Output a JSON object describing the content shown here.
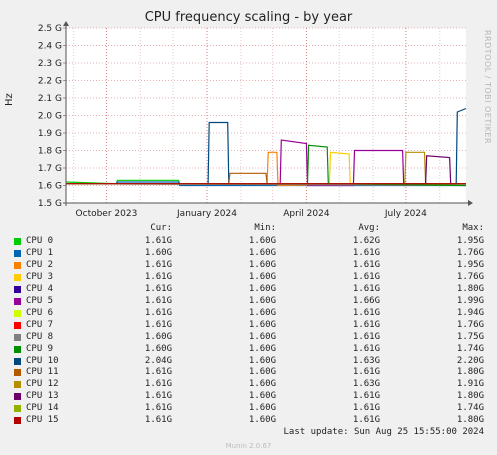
{
  "title": "CPU frequency scaling - by year",
  "side_credit": "RRDTOOL / TOBI OETIKER",
  "footer": {
    "last_update": "Last update: Sun Aug 25 15:55:00 2024",
    "generator": "Munin 2.0.67"
  },
  "legend_headers": {
    "cur": "Cur:",
    "min": "Min:",
    "avg": "Avg:",
    "max": "Max:"
  },
  "chart_data": {
    "type": "line",
    "title": "CPU frequency scaling - by year",
    "ylabel": "Hz",
    "ylim": [
      1.5,
      2.5
    ],
    "y_ticks": [
      {
        "value": 2.5,
        "label": "2.5 G"
      },
      {
        "value": 2.4,
        "label": "2.4 G"
      },
      {
        "value": 2.3,
        "label": "2.3 G"
      },
      {
        "value": 2.2,
        "label": "2.2 G"
      },
      {
        "value": 2.1,
        "label": "2.1 G"
      },
      {
        "value": 2.0,
        "label": "2.0 G"
      },
      {
        "value": 1.9,
        "label": "1.9 G"
      },
      {
        "value": 1.8,
        "label": "1.8 G"
      },
      {
        "value": 1.7,
        "label": "1.7 G"
      },
      {
        "value": 1.6,
        "label": "1.6 G"
      },
      {
        "value": 1.5,
        "label": "1.5 G"
      }
    ],
    "x_range": [
      "2023-08-25",
      "2024-08-25"
    ],
    "x_ticks": [
      {
        "date": "2023-10-01",
        "label": "October 2023"
      },
      {
        "date": "2024-01-01",
        "label": "January 2024"
      },
      {
        "date": "2024-04-01",
        "label": "April 2024"
      },
      {
        "date": "2024-07-01",
        "label": "July 2024"
      }
    ],
    "x_minor_ticks": [
      "2023-09-01",
      "2023-11-01",
      "2023-12-01",
      "2024-02-01",
      "2024-03-01",
      "2024-05-01",
      "2024-06-01",
      "2024-08-01"
    ],
    "grid": true,
    "legend_position": "bottom",
    "series": [
      {
        "name": "CPU 0",
        "color": "#00cc00",
        "cur": "1.61G",
        "min": "1.60G",
        "avg": "1.62G",
        "max": "1.95G",
        "points": [
          [
            "2023-08-25",
            1.62
          ],
          [
            "2023-10-10",
            1.61
          ],
          [
            "2023-10-11",
            1.63
          ],
          [
            "2023-12-06",
            1.63
          ],
          [
            "2023-12-07",
            1.61
          ],
          [
            "2024-02-20",
            1.61
          ],
          [
            "2024-02-22",
            1.61
          ],
          [
            "2024-08-25",
            1.61
          ]
        ]
      },
      {
        "name": "CPU 1",
        "color": "#0066b3",
        "cur": "1.60G",
        "min": "1.60G",
        "avg": "1.61G",
        "max": "1.76G",
        "points": [
          [
            "2023-08-25",
            1.61
          ],
          [
            "2023-10-10",
            1.61
          ],
          [
            "2023-10-11",
            1.62
          ],
          [
            "2023-12-06",
            1.62
          ],
          [
            "2023-12-07",
            1.6
          ],
          [
            "2024-08-25",
            1.6
          ]
        ]
      },
      {
        "name": "CPU 2",
        "color": "#ff8000",
        "cur": "1.61G",
        "min": "1.60G",
        "avg": "1.61G",
        "max": "1.95G",
        "points": [
          [
            "2023-08-25",
            1.61
          ],
          [
            "2024-02-25",
            1.61
          ],
          [
            "2024-02-26",
            1.79
          ],
          [
            "2024-03-05",
            1.79
          ],
          [
            "2024-03-06",
            1.6
          ],
          [
            "2024-08-25",
            1.61
          ]
        ]
      },
      {
        "name": "CPU 3",
        "color": "#ffcc00",
        "cur": "1.61G",
        "min": "1.60G",
        "avg": "1.61G",
        "max": "1.76G",
        "points": [
          [
            "2023-08-25",
            1.61
          ],
          [
            "2024-04-22",
            1.61
          ],
          [
            "2024-04-23",
            1.79
          ],
          [
            "2024-05-10",
            1.78
          ],
          [
            "2024-05-11",
            1.61
          ],
          [
            "2024-08-25",
            1.61
          ]
        ]
      },
      {
        "name": "CPU 4",
        "color": "#330099",
        "cur": "1.61G",
        "min": "1.60G",
        "avg": "1.61G",
        "max": "1.80G",
        "points": [
          [
            "2023-08-25",
            1.61
          ],
          [
            "2024-08-25",
            1.61
          ]
        ]
      },
      {
        "name": "CPU 5",
        "color": "#990099",
        "cur": "1.61G",
        "min": "1.60G",
        "avg": "1.66G",
        "max": "1.99G",
        "points": [
          [
            "2023-08-25",
            1.61
          ],
          [
            "2024-03-08",
            1.61
          ],
          [
            "2024-03-09",
            1.86
          ],
          [
            "2024-04-01",
            1.84
          ],
          [
            "2024-04-02",
            1.6
          ],
          [
            "2024-05-14",
            1.6
          ],
          [
            "2024-05-15",
            1.8
          ],
          [
            "2024-06-28",
            1.8
          ],
          [
            "2024-06-29",
            1.6
          ],
          [
            "2024-08-25",
            1.61
          ]
        ]
      },
      {
        "name": "CPU 6",
        "color": "#ccff00",
        "cur": "1.61G",
        "min": "1.60G",
        "avg": "1.61G",
        "max": "1.94G",
        "points": [
          [
            "2023-08-25",
            1.61
          ],
          [
            "2024-08-25",
            1.61
          ]
        ]
      },
      {
        "name": "CPU 7",
        "color": "#ff0000",
        "cur": "1.61G",
        "min": "1.60G",
        "avg": "1.61G",
        "max": "1.76G",
        "points": [
          [
            "2023-08-25",
            1.61
          ],
          [
            "2024-08-25",
            1.61
          ]
        ]
      },
      {
        "name": "CPU 8",
        "color": "#808080",
        "cur": "1.60G",
        "min": "1.60G",
        "avg": "1.61G",
        "max": "1.75G",
        "points": [
          [
            "2023-08-25",
            1.61
          ],
          [
            "2024-08-25",
            1.6
          ]
        ]
      },
      {
        "name": "CPU 9",
        "color": "#008f00",
        "cur": "1.60G",
        "min": "1.60G",
        "avg": "1.61G",
        "max": "1.74G",
        "points": [
          [
            "2023-08-25",
            1.61
          ],
          [
            "2024-04-02",
            1.61
          ],
          [
            "2024-04-03",
            1.83
          ],
          [
            "2024-04-20",
            1.82
          ],
          [
            "2024-04-21",
            1.61
          ],
          [
            "2024-08-25",
            1.6
          ]
        ]
      },
      {
        "name": "CPU 10",
        "color": "#00487d",
        "cur": "2.04G",
        "min": "1.60G",
        "avg": "1.63G",
        "max": "2.20G",
        "points": [
          [
            "2023-08-25",
            1.61
          ],
          [
            "2024-01-02",
            1.61
          ],
          [
            "2024-01-03",
            1.96
          ],
          [
            "2024-01-20",
            1.96
          ],
          [
            "2024-01-21",
            1.61
          ],
          [
            "2024-08-16",
            1.61
          ],
          [
            "2024-08-17",
            2.02
          ],
          [
            "2024-08-25",
            2.04
          ]
        ]
      },
      {
        "name": "CPU 11",
        "color": "#b35a00",
        "cur": "1.61G",
        "min": "1.60G",
        "avg": "1.61G",
        "max": "1.80G",
        "points": [
          [
            "2023-08-25",
            1.61
          ],
          [
            "2024-01-21",
            1.61
          ],
          [
            "2024-01-22",
            1.67
          ],
          [
            "2024-02-24",
            1.67
          ],
          [
            "2024-02-25",
            1.61
          ],
          [
            "2024-08-25",
            1.61
          ]
        ]
      },
      {
        "name": "CPU 12",
        "color": "#b38f00",
        "cur": "1.61G",
        "min": "1.60G",
        "avg": "1.63G",
        "max": "1.91G",
        "points": [
          [
            "2023-08-25",
            1.61
          ],
          [
            "2024-06-30",
            1.61
          ],
          [
            "2024-07-01",
            1.79
          ],
          [
            "2024-07-18",
            1.79
          ],
          [
            "2024-07-19",
            1.61
          ],
          [
            "2024-08-25",
            1.61
          ]
        ]
      },
      {
        "name": "CPU 13",
        "color": "#6b006b",
        "cur": "1.61G",
        "min": "1.60G",
        "avg": "1.61G",
        "max": "1.80G",
        "points": [
          [
            "2023-08-25",
            1.61
          ],
          [
            "2024-07-19",
            1.61
          ],
          [
            "2024-07-20",
            1.77
          ],
          [
            "2024-08-10",
            1.76
          ],
          [
            "2024-08-11",
            1.61
          ],
          [
            "2024-08-25",
            1.61
          ]
        ]
      },
      {
        "name": "CPU 14",
        "color": "#8fb300",
        "cur": "1.61G",
        "min": "1.60G",
        "avg": "1.61G",
        "max": "1.74G",
        "points": [
          [
            "2023-08-25",
            1.61
          ],
          [
            "2024-08-25",
            1.61
          ]
        ]
      },
      {
        "name": "CPU 15",
        "color": "#b30000",
        "cur": "1.61G",
        "min": "1.60G",
        "avg": "1.61G",
        "max": "1.80G",
        "points": [
          [
            "2023-08-25",
            1.61
          ],
          [
            "2024-08-25",
            1.61
          ]
        ]
      }
    ]
  }
}
